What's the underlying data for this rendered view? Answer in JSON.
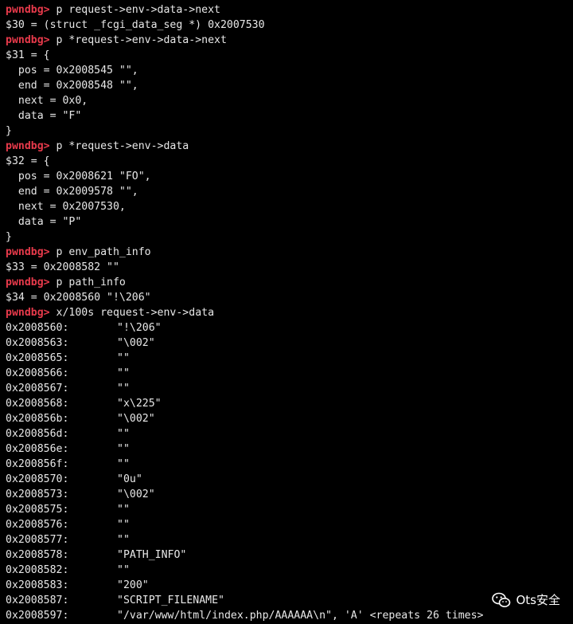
{
  "terminal": {
    "lines": [
      {
        "prompt": "pwndbg>",
        "text": " p request->env->data->next"
      },
      {
        "text": "$30 = (struct _fcgi_data_seg *) 0x2007530"
      },
      {
        "prompt": "pwndbg>",
        "text": " p *request->env->data->next"
      },
      {
        "text": "$31 = {"
      },
      {
        "text": "  pos = 0x2008545 \"\","
      },
      {
        "text": "  end = 0x2008548 \"\","
      },
      {
        "text": "  next = 0x0,"
      },
      {
        "text": "  data = \"F\""
      },
      {
        "text": "}"
      },
      {
        "prompt": "pwndbg>",
        "text": " p *request->env->data"
      },
      {
        "text": "$32 = {"
      },
      {
        "text": "  pos = 0x2008621 \"FO\","
      },
      {
        "text": "  end = 0x2009578 \"\","
      },
      {
        "text": "  next = 0x2007530,"
      },
      {
        "text": "  data = \"P\""
      },
      {
        "text": "}"
      },
      {
        "prompt": "pwndbg>",
        "text": " p env_path_info"
      },
      {
        "text": "$33 = 0x2008582 \"\""
      },
      {
        "prompt": "pwndbg>",
        "text": " p path_info"
      },
      {
        "text": "$34 = 0x2008560 \"!\\206\""
      },
      {
        "prompt": "pwndbg>",
        "text": " x/100s request->env->data"
      },
      {
        "addr": "0x2008560:",
        "val": "\"!\\206\""
      },
      {
        "addr": "0x2008563:",
        "val": "\"\\002\""
      },
      {
        "addr": "0x2008565:",
        "val": "\"\""
      },
      {
        "addr": "0x2008566:",
        "val": "\"\""
      },
      {
        "addr": "0x2008567:",
        "val": "\"\""
      },
      {
        "addr": "0x2008568:",
        "val": "\"x\\225\""
      },
      {
        "addr": "0x200856b:",
        "val": "\"\\002\""
      },
      {
        "addr": "0x200856d:",
        "val": "\"\""
      },
      {
        "addr": "0x200856e:",
        "val": "\"\""
      },
      {
        "addr": "0x200856f:",
        "val": "\"\""
      },
      {
        "addr": "0x2008570:",
        "val": "\"0u\""
      },
      {
        "addr": "0x2008573:",
        "val": "\"\\002\""
      },
      {
        "addr": "0x2008575:",
        "val": "\"\""
      },
      {
        "addr": "0x2008576:",
        "val": "\"\""
      },
      {
        "addr": "0x2008577:",
        "val": "\"\""
      },
      {
        "addr": "0x2008578:",
        "val": "\"PATH_INFO\""
      },
      {
        "addr": "0x2008582:",
        "val": "\"\""
      },
      {
        "addr": "0x2008583:",
        "val": "\"200\""
      },
      {
        "addr": "0x2008587:",
        "val": "\"SCRIPT_FILENAME\""
      },
      {
        "addr": "0x2008597:",
        "val": "\"/var/www/html/index.php/AAAAAA\\n\", 'A' <repeats 26 times>"
      }
    ]
  },
  "watermark": {
    "icon": "wechat-icon",
    "text": "Ots安全"
  },
  "colors": {
    "background": "#000000",
    "prompt": "#e83a4b",
    "text": "#e8e8e8"
  }
}
